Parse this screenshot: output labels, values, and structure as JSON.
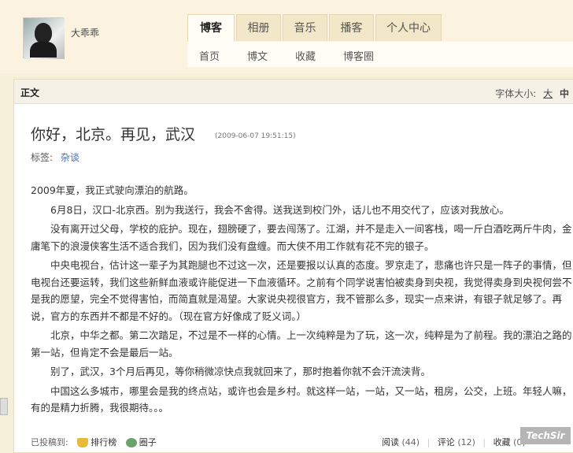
{
  "header": {
    "username": "大乖乖",
    "tabs": [
      "博客",
      "相册",
      "音乐",
      "播客",
      "个人中心"
    ],
    "active_tab": "博客",
    "subnav": [
      "首页",
      "博文",
      "收藏",
      "博客圈"
    ]
  },
  "panel": {
    "label": "正文",
    "font_size_label": "字体大小:",
    "font_size_options": [
      "大",
      "中"
    ]
  },
  "article": {
    "title": "你好，北京。再见，武汉",
    "date": "(2009-06-07 19:51:15)",
    "tags_label": "标签:",
    "tag": "杂谈",
    "paragraphs": [
      "2009年夏，我正式驶向漂泊的航路。",
      "6月8日，汉口-北京西。别为我送行，我会不舍得。送我送到校门外，话儿也不用交代了，应该对我放心。",
      "没有离开过父母，学校的庇护。现在，翅膀硬了，要去闯荡了。江湖，并不是走入一间客栈，喝一斤白酒吃两斤牛肉，金庸笔下的浪漫侠客生活不适合我们，因为我们没有盘缠。而大侠不用工作就有花不完的银子。",
      "中央电视台，估计这一辈子为其跑腿也不过这一次，还是要报以认真的态度。罗京走了，悲痛也许只是一阵子的事情，但电视台还要运转，我们这些新鲜血液或许能促进一下血液循环。之前有个同学说害怕被卖身到央视，我觉得卖身到央视何尝不是我的愿望，完全不觉得害怕，而简直就是渴望。大家说央视很官方，我不管那么多，现实一点来讲，有银子就足够了。再说，官方的东西并不都是不好的。（现在官方好像成了贬义词。）",
      "北京，中华之都。第二次踏足，不过是不一样的心情。上一次纯粹是为了玩，这一次，纯粹是为了前程。我的漂泊之路的第一站，但肯定不会是最后一站。",
      "别了，武汉，3个月后再见，等你稍微凉快点我就回来了，那时抱着你就不会汗流浃背。",
      "中国这么多城市，哪里会是我的终点站，或许也会是乡村。就这样一站，一站，又一站，租房，公交，上班。年轻人嘛，有的是精力折腾，我很期待。。。"
    ]
  },
  "footer": {
    "posted_to": "已投稿到:",
    "rank_link": "排行榜",
    "circle_link": "圈子",
    "read_label": "阅读",
    "read_count": "(44)",
    "comment_label": "评论",
    "comment_count": "(12)",
    "collect_label": "收藏",
    "collect_count": "(0)"
  },
  "watermark": "TechSir"
}
